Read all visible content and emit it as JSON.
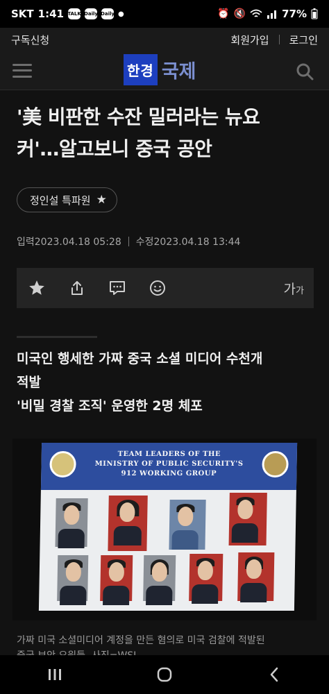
{
  "status_bar": {
    "carrier": "SKT",
    "time": "1:41",
    "apps": [
      "TALK",
      "Daily",
      "Daily"
    ],
    "battery": "77%"
  },
  "top_bar": {
    "subscribe": "구독신청",
    "signup": "회원가입",
    "login": "로그인"
  },
  "header": {
    "logo": "한경",
    "section": "국제",
    "menu_icon": "hamburger-icon",
    "search_icon": "search-icon"
  },
  "article": {
    "headline_line1": "'美 비판한 수잔 밀러라는 뉴요",
    "headline_line2": "커'…알고보니 중국 공안",
    "reporter": "정인설 특파원",
    "input_label": "입력",
    "input_date": "2023.04.18 05:28",
    "modified_label": "수정",
    "modified_date": "2023.04.18 13:44",
    "subhead_line1": "미국인 행세한 가짜 중국 소셜 미디어 수천개",
    "subhead_line2": "적발",
    "subhead_line3": "'비밀 경찰 조직' 운영한 2명 체포",
    "caption_line1": "가짜 미국 소셜미디어 계정을 만든 혐의로 미국 검찰에 적발된",
    "caption_line2": "중국 보안 요원들. 사진=WSJ"
  },
  "photo": {
    "slide_line1": "TEAM LEADERS OF THE",
    "slide_line2": "MINISTRY OF PUBLIC SECURITY'S",
    "slide_line3": "912 WORKING GROUP"
  },
  "toolbar": {
    "icons": [
      "star-icon",
      "share-icon",
      "comment-icon",
      "smile-icon"
    ],
    "font_big": "가",
    "font_small": "가"
  }
}
